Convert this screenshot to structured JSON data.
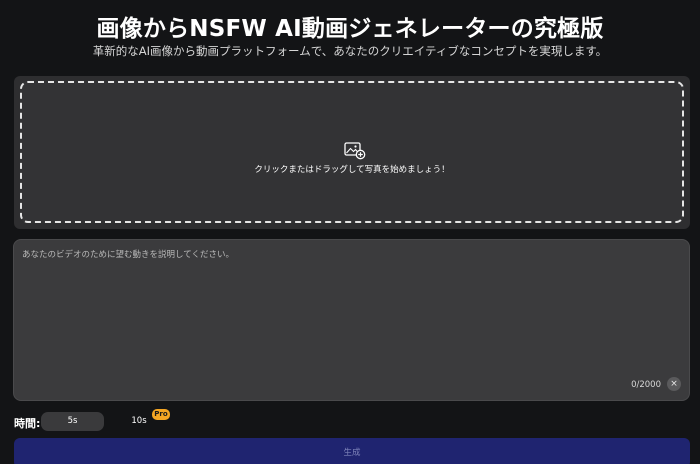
{
  "header": {
    "title": "画像からNSFW AI動画ジェネレーターの究極版",
    "subtitle": "革新的なAI画像から動画プラットフォームで、あなたのクリエイティブなコンセプトを実現します。"
  },
  "upload": {
    "icon": "image-add-icon",
    "prompt_text": "クリックまたはドラッグして写真を始めましょう！"
  },
  "description": {
    "placeholder": "あなたのビデオのために望む動きを説明してください。",
    "value": "",
    "char_count": "0/2000",
    "clear_icon": "close-icon",
    "clear_label": "×"
  },
  "duration": {
    "label": "時間:",
    "options": [
      {
        "label": "5s",
        "selected": true
      },
      {
        "label": "10s",
        "selected": false,
        "badge": "Pro"
      }
    ]
  },
  "actions": {
    "generate_label": "生成"
  },
  "colors": {
    "background": "#131416",
    "panel": "#2e2e30",
    "prompt_box": "#3b3b3d",
    "pro_badge": "#f5a623",
    "generate_button": "#1f2470"
  }
}
